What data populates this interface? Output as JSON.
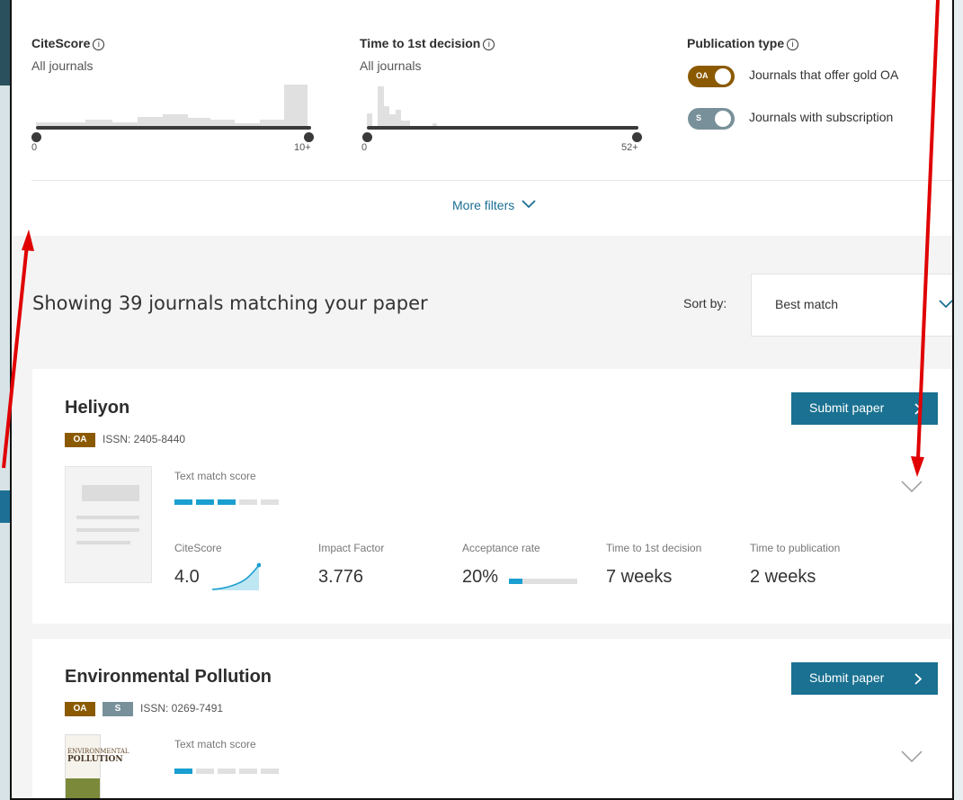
{
  "filters": {
    "citescore": {
      "title": "CiteScore",
      "subtitle": "All journals",
      "min": "0",
      "max": "10+"
    },
    "time_to_first_decision": {
      "title": "Time to 1st decision",
      "subtitle": "All journals",
      "min": "0",
      "max": "52+"
    },
    "publication_type": {
      "title": "Publication type",
      "gold_oa_label": "Journals that offer gold OA",
      "gold_oa_toggle": "OA",
      "subscription_label": "Journals with subscription",
      "subscription_toggle": "S"
    },
    "info_glyph": "i",
    "more_filters": "More filters"
  },
  "results": {
    "showing": "Showing 39 journals matching your paper",
    "sort_label": "Sort by:",
    "sort_value": "Best match"
  },
  "journals": [
    {
      "title": "Heliyon",
      "badges": [
        "OA"
      ],
      "issn": "ISSN: 2405-8440",
      "submit_label": "Submit paper",
      "text_match_label": "Text match score",
      "text_match_score": 3,
      "text_match_max": 5,
      "metrics": {
        "citescore_label": "CiteScore",
        "citescore_value": "4.0",
        "impact_label": "Impact Factor",
        "impact_value": "3.776",
        "acceptance_label": "Acceptance rate",
        "acceptance_value": "20%",
        "acceptance_fraction": 0.2,
        "decision_label": "Time to 1st decision",
        "decision_value": "7 weeks",
        "publication_label": "Time to publication",
        "publication_value": "2 weeks"
      }
    },
    {
      "title": "Environmental Pollution",
      "badges": [
        "OA",
        "S"
      ],
      "issn": "ISSN: 0269-7491",
      "submit_label": "Submit paper",
      "text_match_label": "Text match score",
      "text_match_score": 1,
      "text_match_max": 5,
      "cover_text_top": "ENVIRONMENTAL",
      "cover_text_main": "POLLUTION"
    }
  ],
  "colors": {
    "accent": "#1a7191",
    "link": "#1b6f93",
    "oa": "#8b5a00",
    "subscription": "#78909a",
    "score_filled": "#1a9fd0",
    "score_empty": "#e0e0e0",
    "annotation_arrow": "#e00000"
  }
}
